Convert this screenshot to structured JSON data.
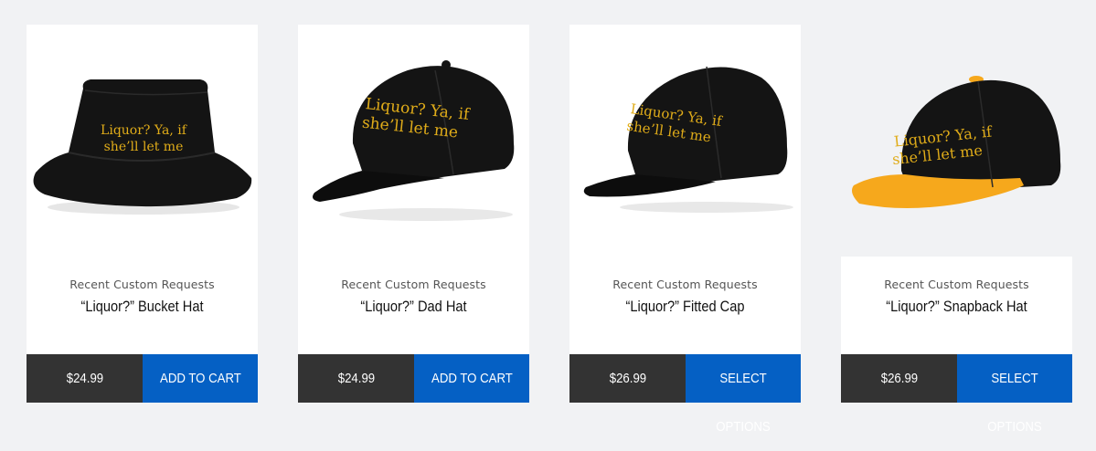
{
  "products": [
    {
      "category": "Recent Custom Requests",
      "title": "“Liquor?” Bucket Hat",
      "price": "$24.99",
      "action": "ADD TO CART",
      "print_line1": "Liquor? Ya, if",
      "print_line2": "she’ll let me",
      "hat_icon": "bucket-hat"
    },
    {
      "category": "Recent Custom Requests",
      "title": "“Liquor?” Dad Hat",
      "price": "$24.99",
      "action": "ADD TO CART",
      "print_line1": "Liquor? Ya, if",
      "print_line2": "she’ll let me",
      "hat_icon": "dad-hat"
    },
    {
      "category": "Recent Custom Requests",
      "title": "“Liquor?” Fitted Cap",
      "price": "$26.99",
      "action": "SELECT OPTIONS",
      "print_line1": "Liquor? Ya, if",
      "print_line2": "she’ll let me",
      "hat_icon": "fitted-cap"
    },
    {
      "category": "Recent Custom Requests",
      "title": "“Liquor?” Snapback Hat",
      "price": "$26.99",
      "action": "SELECT OPTIONS",
      "print_line1": "Liquor? Ya, if",
      "print_line2": "she’ll let me",
      "hat_icon": "snapback-hat"
    }
  ],
  "colors": {
    "page_background": "#f1f2f4",
    "price_bar": "#333333",
    "action_button": "#0560c4",
    "hat_body": "#111111",
    "embroidery": "#e0ac19",
    "snapback_brim": "#f6a81c"
  }
}
